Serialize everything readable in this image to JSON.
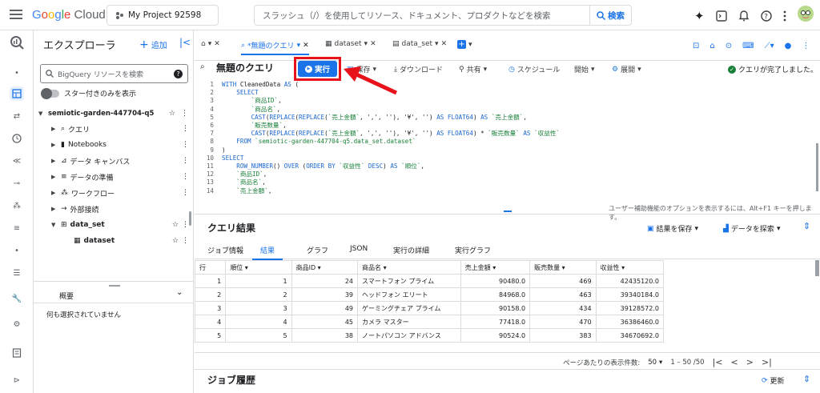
{
  "topbar": {
    "logo": "Google Cloud",
    "project": "My Project 92598",
    "search_placeholder": "スラッシュ（/）を使用してリソース、ドキュメント、プロダクトなどを検索",
    "search_button": "検索"
  },
  "explorer": {
    "title": "エクスプローラ",
    "add": "追加",
    "search_placeholder": "BigQuery リソースを検索",
    "starred_only": "スター付きのみを表示",
    "project": "semiotic-garden-447704-q5",
    "items": [
      {
        "label": "クエリ"
      },
      {
        "label": "Notebooks"
      },
      {
        "label": "データ キャンバス"
      },
      {
        "label": "データの準備"
      },
      {
        "label": "ワークフロー"
      },
      {
        "label": "外部接続"
      },
      {
        "label": "data_set"
      }
    ],
    "table": "dataset",
    "summary": "概要",
    "nothing_selected": "何も選択されていません"
  },
  "tabs": [
    {
      "label": "*無題のクエリ"
    },
    {
      "label": "dataset"
    },
    {
      "label": "data_set"
    }
  ],
  "query": {
    "title": "無題のクエリ",
    "run": "実行",
    "save": "保存",
    "download": "ダウンロード",
    "share": "共有",
    "schedule": "スケジュール",
    "start": "開始",
    "deploy": "展開",
    "status": "クエリが完了しました。",
    "accessibility": "ユーザー補助機能のオプションを表示するには、Alt+F1 キーを押します。"
  },
  "code_lines": [
    "WITH CleanedData AS (",
    "    SELECT",
    "        `商品ID`,",
    "        `商品名`,",
    "        CAST(REPLACE(REPLACE(`売上金額`, ',', ''), '¥', '') AS FLOAT64) AS `売上金額`,",
    "        `販売数量`,",
    "        CAST(REPLACE(REPLACE(`売上金額`, ',', ''), '¥', '') AS FLOAT64) * `販売数量` AS `収益性`",
    "    FROM `semiotic-garden-447704-q5.data_set.dataset`",
    ")",
    "SELECT",
    "    ROW_NUMBER() OVER (ORDER BY `収益性` DESC) AS `順位`,",
    "    `商品ID`,",
    "    `商品名`,",
    "    `売上金額`,"
  ],
  "results": {
    "title": "クエリ結果",
    "save_results": "結果を保存",
    "explore_data": "データを探索",
    "tabs": [
      "ジョブ情報",
      "結果",
      "グラフ",
      "JSON",
      "実行の詳細",
      "実行グラフ"
    ],
    "columns": [
      "行",
      "順位",
      "商品ID",
      "商品名",
      "売上金額",
      "販売数量",
      "収益性"
    ],
    "rows": [
      [
        "1",
        "1",
        "24",
        "スマートフォン プライム",
        "90480.0",
        "469",
        "42435120.0"
      ],
      [
        "2",
        "2",
        "39",
        "ヘッドフォン エリート",
        "84968.0",
        "463",
        "39340184.0"
      ],
      [
        "3",
        "3",
        "49",
        "ゲーミングチェア プライム",
        "90158.0",
        "434",
        "39128572.0"
      ],
      [
        "4",
        "4",
        "45",
        "カメラ マスター",
        "77418.0",
        "470",
        "36386460.0"
      ],
      [
        "5",
        "5",
        "38",
        "ノートパソコン アドバンス",
        "90524.0",
        "383",
        "34670692.0"
      ]
    ],
    "per_page_label": "ページあたりの表示件数:",
    "per_page": "50",
    "range": "1 – 50 /50"
  },
  "job_history": {
    "title": "ジョブ履歴",
    "refresh": "更新"
  },
  "colors": {
    "accent": "#1a73e8",
    "highlight": "#e8121a"
  }
}
